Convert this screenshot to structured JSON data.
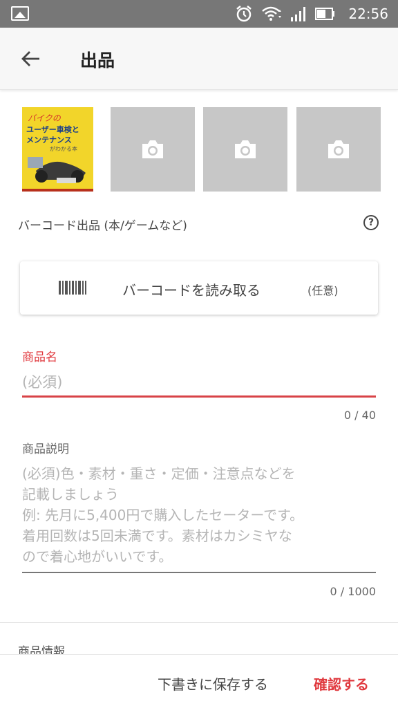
{
  "status_bar": {
    "time": "22:56",
    "icons": [
      "gallery-icon",
      "alarm-icon",
      "wifi-icon",
      "signal-icon",
      "battery-icon"
    ]
  },
  "app_bar": {
    "title": "出品",
    "back_icon": "arrow-left-icon"
  },
  "photos": {
    "thumbnail": {
      "cover_title_line1": "バイクの",
      "cover_title_line2": "ユーザー車検と",
      "cover_title_line3": "メンテナンス",
      "cover_title_line4": "がわかる本"
    },
    "placeholder_icon": "camera-icon",
    "placeholder_count": 3
  },
  "barcode": {
    "label": "バーコード出品 (本/ゲームなど)",
    "help_icon": "question-circle-icon",
    "help_glyph": "?",
    "button_label": "バーコードを読み取る",
    "optional_label": "(任意)",
    "button_icon": "barcode-icon"
  },
  "product_name": {
    "label": "商品名",
    "placeholder": "(必須)",
    "counter": "0 / 40"
  },
  "description": {
    "label": "商品説明",
    "placeholder": "(必須)色・素材・重さ・定価・注意点などを\n記載しましょう\n例: 先月に5,400円で購入したセーターです。\n着用回数は5回未満です。素材はカシミヤな\nので着心地がいいです。",
    "counter": "0 / 1000"
  },
  "product_info": {
    "section_title": "商品情報"
  },
  "bottom_bar": {
    "draft_label": "下書きに保存する",
    "confirm_label": "確認する"
  },
  "colors": {
    "accent": "#e0393e",
    "status_bar": "#777777",
    "placeholder_tile": "#c7c7c7",
    "app_bar": "#f7f7f7"
  }
}
